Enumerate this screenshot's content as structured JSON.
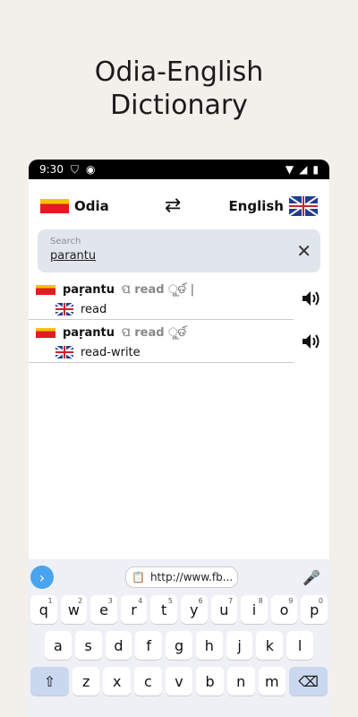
{
  "promo": {
    "line1": "Odia-English",
    "line2": "Dictionary"
  },
  "status": {
    "time": "9:30"
  },
  "lang": {
    "source": "Odia",
    "target": "English"
  },
  "search": {
    "placeholder": "Search",
    "value": "parantu"
  },
  "results": [
    {
      "word": "paṛantu",
      "meta": "ପ read ୁର୍ଡ |",
      "translation": "read"
    },
    {
      "word": "paṛantu",
      "meta": "ପ read ୁର୍ଡ",
      "translation": "read-write"
    }
  ],
  "keyboard": {
    "url": "http://www.fb...",
    "row1": [
      {
        "k": "q",
        "n": "1"
      },
      {
        "k": "w",
        "n": "2"
      },
      {
        "k": "e",
        "n": "3"
      },
      {
        "k": "r",
        "n": "4"
      },
      {
        "k": "t",
        "n": "5"
      },
      {
        "k": "y",
        "n": "6"
      },
      {
        "k": "u",
        "n": "7"
      },
      {
        "k": "i",
        "n": "8"
      },
      {
        "k": "o",
        "n": "9"
      },
      {
        "k": "p",
        "n": "0"
      }
    ],
    "row2": [
      "a",
      "s",
      "d",
      "f",
      "g",
      "h",
      "j",
      "k",
      "l"
    ],
    "row3": [
      "z",
      "x",
      "c",
      "v",
      "b",
      "n",
      "m"
    ]
  }
}
